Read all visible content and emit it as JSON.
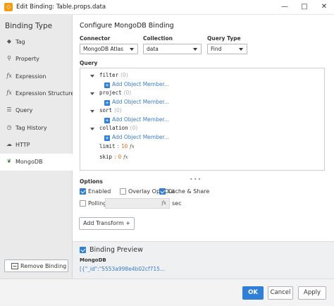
{
  "window": {
    "title": "Edit Binding: Table.props.data",
    "icon": "ignition-app-icon",
    "minimize_glyph": "—",
    "maximize_glyph": "□",
    "close_glyph": "✕"
  },
  "sidebar": {
    "title": "Binding Type",
    "items": [
      {
        "label": "Tag",
        "icon": "tag-icon",
        "glyph": "◆"
      },
      {
        "label": "Property",
        "icon": "link-icon",
        "glyph": "⚲"
      },
      {
        "label": "Expression",
        "icon": "fx-icon",
        "glyph": "fx"
      },
      {
        "label": "Expression Structure",
        "icon": "fx-structure-icon",
        "glyph": "fx"
      },
      {
        "label": "Query",
        "icon": "database-icon",
        "glyph": "☰"
      },
      {
        "label": "Tag History",
        "icon": "clock-icon",
        "glyph": "◷"
      },
      {
        "label": "HTTP",
        "icon": "cloud-icon",
        "glyph": "☁"
      },
      {
        "label": "MongoDB",
        "icon": "leaf-icon",
        "glyph": "❦",
        "active": true
      }
    ],
    "remove_label": "Remove Binding"
  },
  "config": {
    "title": "Configure MongoDB Binding",
    "connector_label": "Connector",
    "connector_value": "MongoDB Atlas",
    "collection_label": "Collection",
    "collection_value": "data",
    "query_type_label": "Query Type",
    "query_type_value": "Find"
  },
  "query": {
    "label": "Query",
    "objects": [
      {
        "key": "filter",
        "count": "(0)"
      },
      {
        "key": "project",
        "count": "(0)"
      },
      {
        "key": "sort",
        "count": "(0)"
      },
      {
        "key": "collation",
        "count": "(0)"
      }
    ],
    "add_member_label": "Add Object Member...",
    "limit": {
      "key": "limit",
      "value": "10"
    },
    "skip": {
      "key": "skip",
      "value": "0"
    },
    "fx": "fx",
    "resize_grip": "•••"
  },
  "options": {
    "label": "Options",
    "enabled": {
      "label": "Enabled",
      "checked": true
    },
    "overlay_opt_out": {
      "label": "Overlay Opt-Out",
      "checked": false
    },
    "cache_share": {
      "label": "Cache & Share",
      "checked": true
    },
    "polling": {
      "label": "Polling",
      "checked": false,
      "unit": "sec",
      "fx": "fx"
    }
  },
  "transform": {
    "add_label": "Add Transform +"
  },
  "preview": {
    "title": "Binding Preview",
    "checked": true,
    "source": "MongoDB",
    "value": "[{\"_id\":\"5553a998e4b02cf715..."
  },
  "footer": {
    "ok_label": "OK",
    "cancel_label": "Cancel",
    "apply_label": "Apply"
  },
  "colors": {
    "accent": "#2f7ed8",
    "link": "#3b7dc4",
    "number": "#e07020",
    "sidebar_bg": "#eaeaea"
  }
}
